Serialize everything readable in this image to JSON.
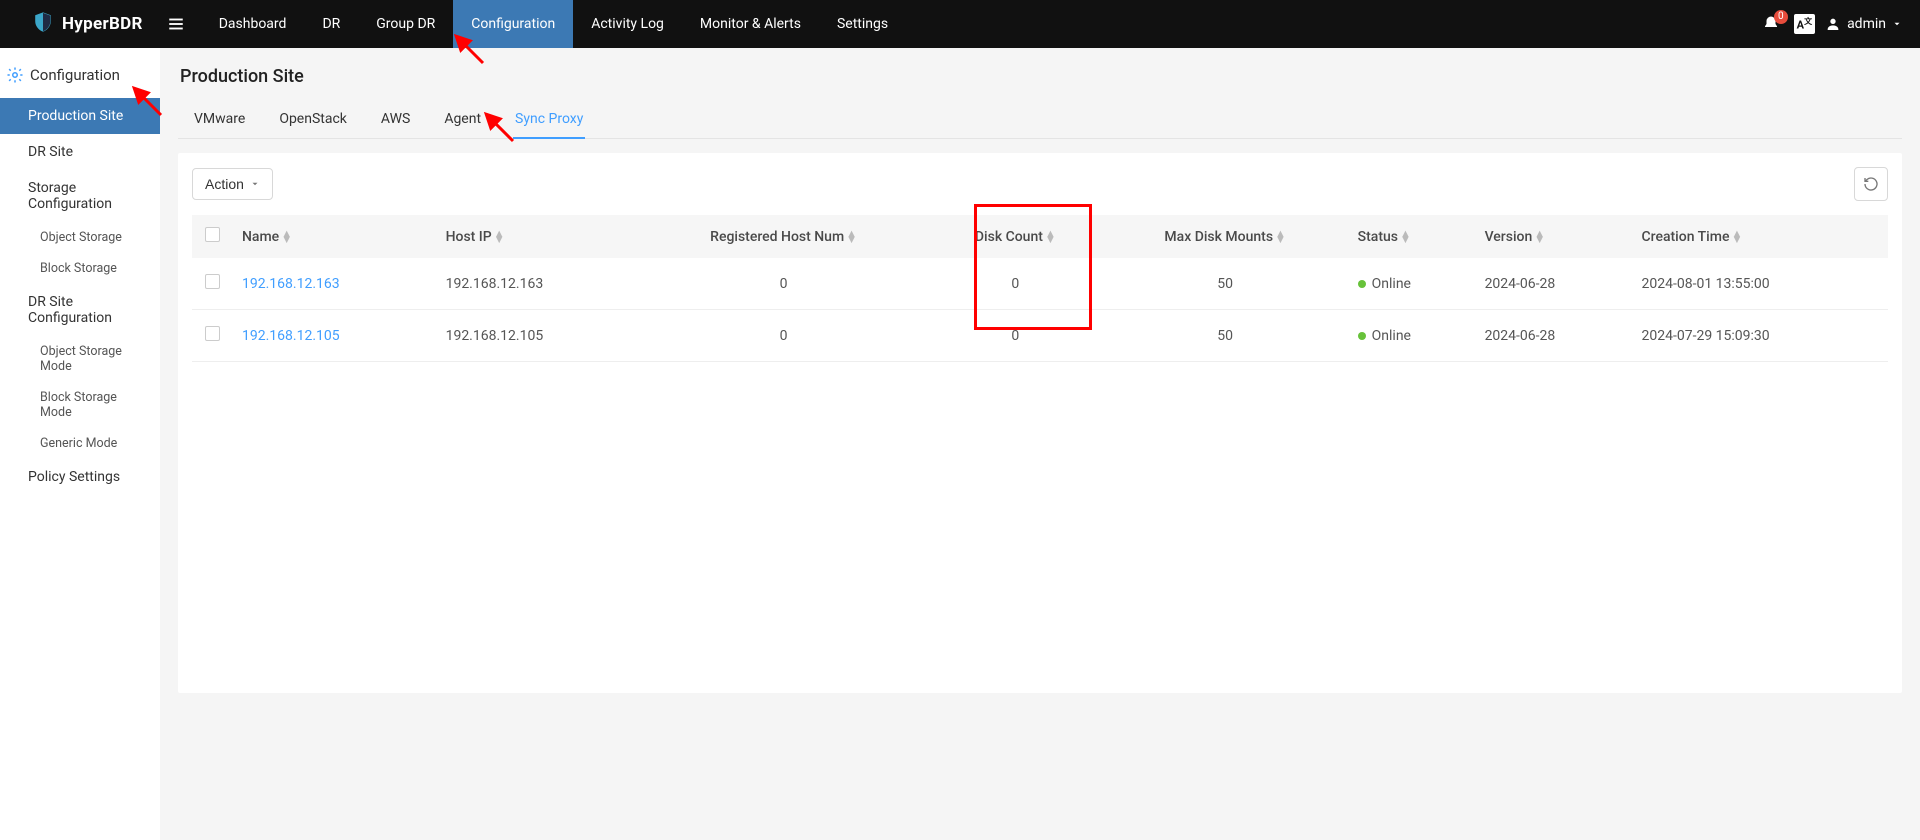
{
  "app": {
    "name": "HyperBDR"
  },
  "topnav": {
    "items": [
      {
        "label": "Dashboard"
      },
      {
        "label": "DR"
      },
      {
        "label": "Group DR"
      },
      {
        "label": "Configuration",
        "active": true
      },
      {
        "label": "Activity Log"
      },
      {
        "label": "Monitor & Alerts"
      },
      {
        "label": "Settings"
      }
    ]
  },
  "topbar_right": {
    "badge_count": "0",
    "lang": "A",
    "user": "admin"
  },
  "sidebar": {
    "title": "Configuration",
    "items": [
      {
        "label": "Production Site",
        "active": true,
        "type": "item"
      },
      {
        "label": "DR Site",
        "type": "item"
      },
      {
        "label": "Storage Configuration",
        "type": "item"
      },
      {
        "label": "Object Storage",
        "type": "sub"
      },
      {
        "label": "Block Storage",
        "type": "sub"
      },
      {
        "label": "DR Site Configuration",
        "type": "item"
      },
      {
        "label": "Object Storage Mode",
        "type": "sub"
      },
      {
        "label": "Block Storage Mode",
        "type": "sub"
      },
      {
        "label": "Generic Mode",
        "type": "sub"
      },
      {
        "label": "Policy Settings",
        "type": "item"
      }
    ]
  },
  "page": {
    "title": "Production Site"
  },
  "tabs": [
    {
      "label": "VMware"
    },
    {
      "label": "OpenStack"
    },
    {
      "label": "AWS"
    },
    {
      "label": "Agent"
    },
    {
      "label": "Sync Proxy",
      "active": true
    }
  ],
  "actions": {
    "action_label": "Action"
  },
  "table": {
    "headers": {
      "name": "Name",
      "host_ip": "Host IP",
      "reg_num": "Registered Host Num",
      "disk_count": "Disk Count",
      "max_mounts": "Max Disk Mounts",
      "status": "Status",
      "version": "Version",
      "ctime": "Creation Time"
    },
    "rows": [
      {
        "name": "192.168.12.163",
        "host_ip": "192.168.12.163",
        "reg_num": "0",
        "disk_count": "0",
        "max_mounts": "50",
        "status": "Online",
        "version": "2024-06-28",
        "ctime": "2024-08-01 13:55:00"
      },
      {
        "name": "192.168.12.105",
        "host_ip": "192.168.12.105",
        "reg_num": "0",
        "disk_count": "0",
        "max_mounts": "50",
        "status": "Online",
        "version": "2024-06-28",
        "ctime": "2024-07-29 15:09:30"
      }
    ]
  }
}
